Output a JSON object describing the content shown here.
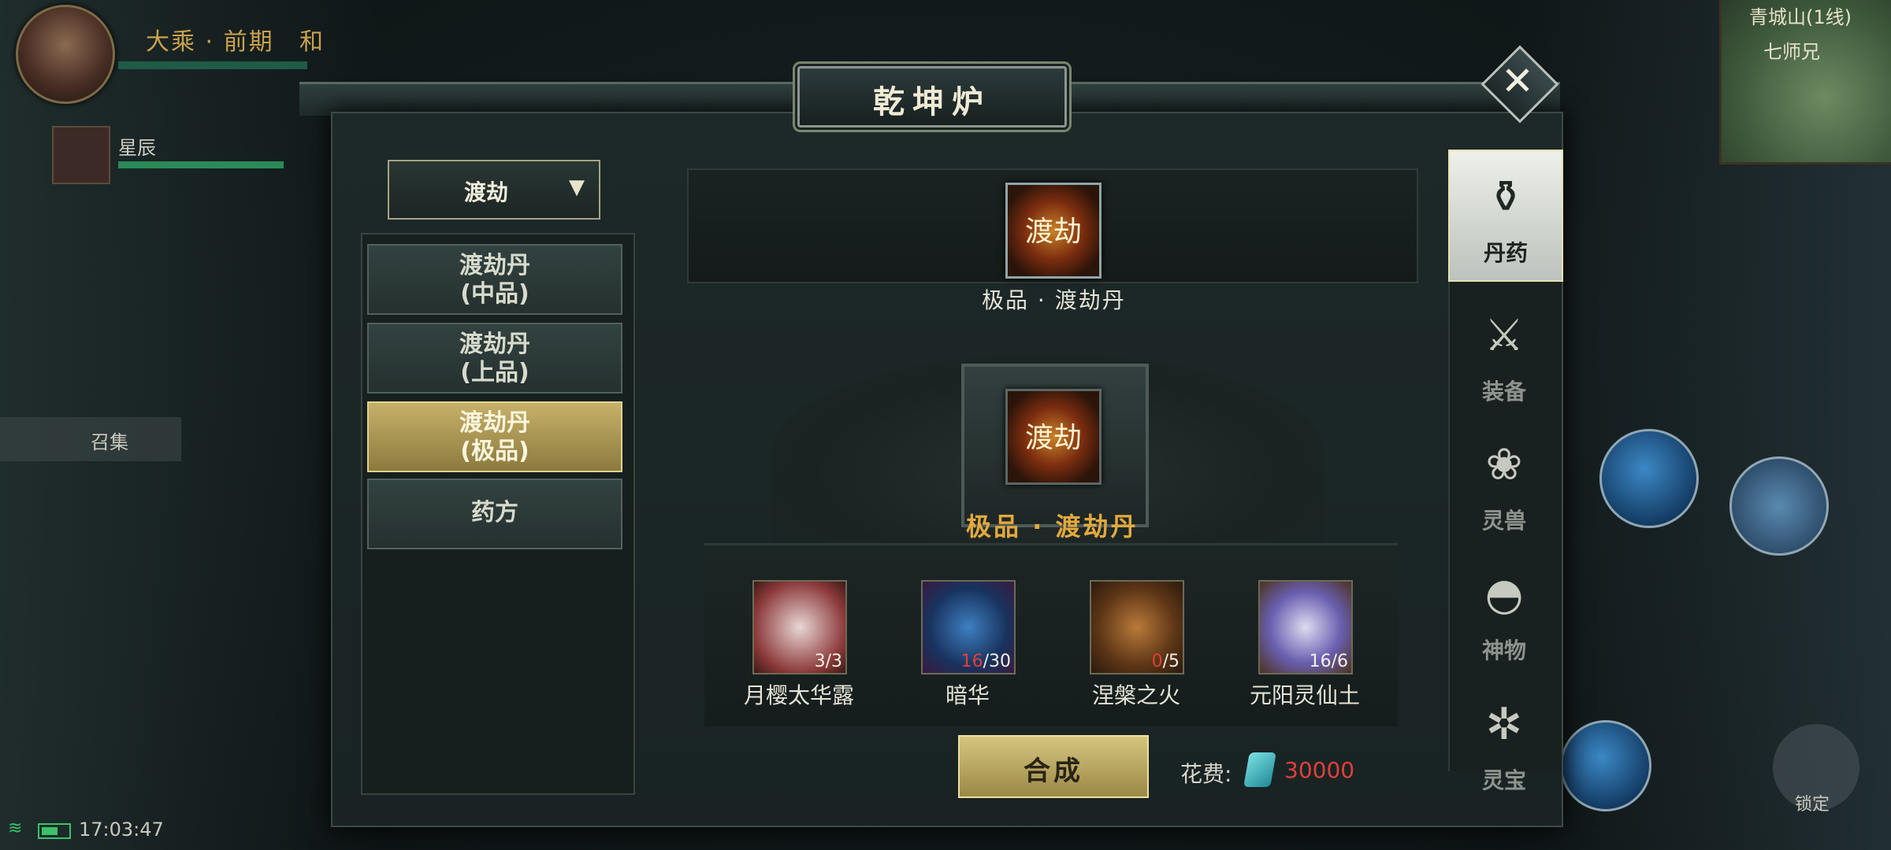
{
  "window": {
    "title": "乾坤炉",
    "close_icon": "close-icon"
  },
  "hud": {
    "player_realm": "大乘 · 前期",
    "player_extra": "和",
    "party_member": "星辰",
    "summon_label": "召集",
    "clock": "17:03:47",
    "minimap_line1": "青城山(1线)",
    "minimap_line2": "七师兄",
    "lock_label": "锁定"
  },
  "category": {
    "selected": "渡劫"
  },
  "recipes": [
    {
      "line1": "渡劫丹",
      "line2": "(中品)",
      "selected": false
    },
    {
      "line1": "渡劫丹",
      "line2": "(上品)",
      "selected": false
    },
    {
      "line1": "渡劫丹",
      "line2": "(极品)",
      "selected": true
    },
    {
      "line1": "药方",
      "line2": "",
      "selected": false
    }
  ],
  "result": {
    "name": "极品 · 渡劫丹",
    "icon_glyph": "渡劫"
  },
  "target": {
    "name": "极品 · 渡劫丹",
    "icon_glyph": "渡劫"
  },
  "materials": [
    {
      "name": "月樱太华露",
      "have": "3",
      "need": "3",
      "short": false,
      "icon": "flask-icon"
    },
    {
      "name": "暗华",
      "have": "16",
      "need": "30",
      "short": true,
      "icon": "orb-icon"
    },
    {
      "name": "涅槃之火",
      "have": "0",
      "need": "5",
      "short": true,
      "icon": "fire-icon"
    },
    {
      "name": "元阳灵仙土",
      "have": "16",
      "need": "6",
      "short": false,
      "icon": "vase-icon"
    }
  ],
  "craft_button": "合成",
  "cost": {
    "label": "花费:",
    "value": "30000",
    "currency_icon": "spirit-stone-icon"
  },
  "tabs": [
    {
      "label": "丹药",
      "icon": "mortar-icon",
      "selected": true
    },
    {
      "label": "装备",
      "icon": "weapon-icon",
      "selected": false
    },
    {
      "label": "灵兽",
      "icon": "paw-icon",
      "selected": false
    },
    {
      "label": "神物",
      "icon": "fan-icon",
      "selected": false
    },
    {
      "label": "灵宝",
      "icon": "talisman-icon",
      "selected": false
    }
  ],
  "colors": {
    "accent_gold": "#c7b169",
    "warning_red": "#e0403a",
    "result_orange": "#e3a93d"
  }
}
